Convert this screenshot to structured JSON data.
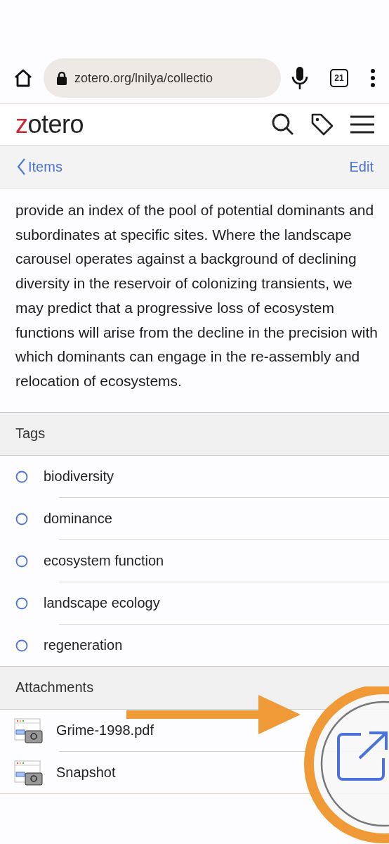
{
  "browser": {
    "url": "zotero.org/lnilya/collectio",
    "tab_count": "21"
  },
  "header": {
    "logo_first": "z",
    "logo_rest": "otero"
  },
  "nav": {
    "back": "Items",
    "edit": "Edit"
  },
  "abstract": "provide an index of the pool of potential dominants and subordinates at specific sites. Where the landscape carousel operates against a background of declining diversity in the reservoir of colonizing transients, we may predict that a progressive loss of ecosystem functions will arise from the decline in the precision with which dominants can engage in the re-assembly and relocation of ecosystems.",
  "tags": {
    "title": "Tags",
    "items": [
      "biodiversity",
      "dominance",
      "ecosystem function",
      "landscape ecology",
      "regeneration"
    ]
  },
  "attachments": {
    "title": "Attachments",
    "items": [
      "Grime-1998.pdf",
      "Snapshot"
    ]
  }
}
